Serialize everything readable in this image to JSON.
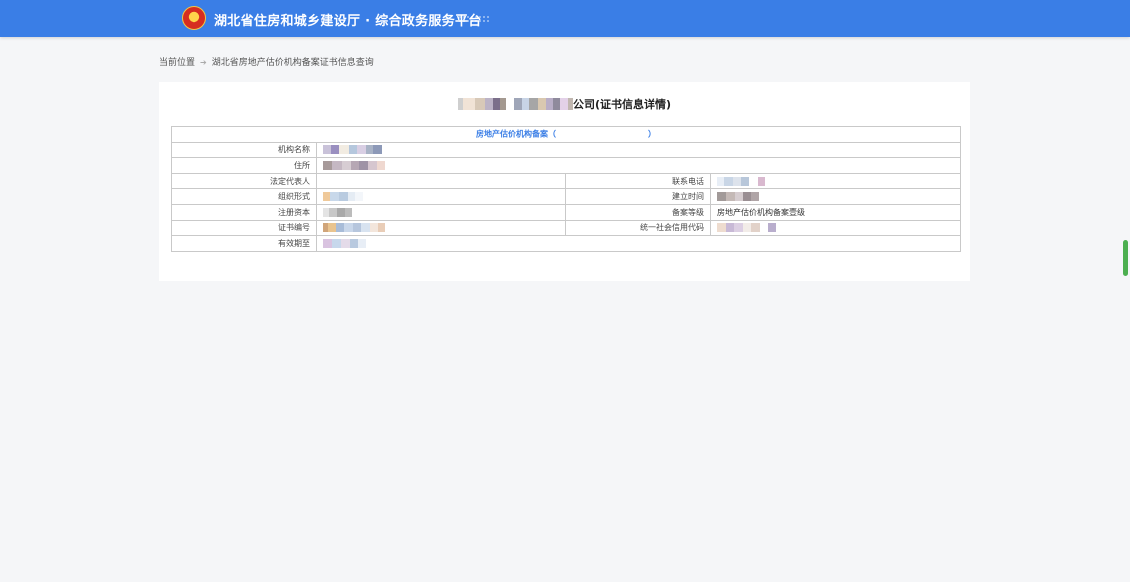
{
  "header": {
    "title": "湖北省住房和城乡建设厅 · 综合政务服务平台",
    "brand_color": "#3a7ee6"
  },
  "breadcrumb": {
    "current_label": "当前位置",
    "page": "湖北省房地产估价机构备案证书信息查询"
  },
  "detail": {
    "heading_suffix": "公司(证书信息详情)",
    "section_title": "房地产估价机构备案（",
    "section_title_end": "）",
    "labels": {
      "org_name": "机构名称",
      "address": "住所",
      "legal_rep": "法定代表人",
      "phone": "联系电话",
      "org_form": "组织形式",
      "established": "建立时间",
      "capital": "注册资本",
      "grade": "备案等级",
      "cert_no": "证书编号",
      "credit_code": "统一社会信用代码",
      "valid_until": "有效期至"
    },
    "values": {
      "grade": "房地产估价机构备案壹级"
    }
  }
}
